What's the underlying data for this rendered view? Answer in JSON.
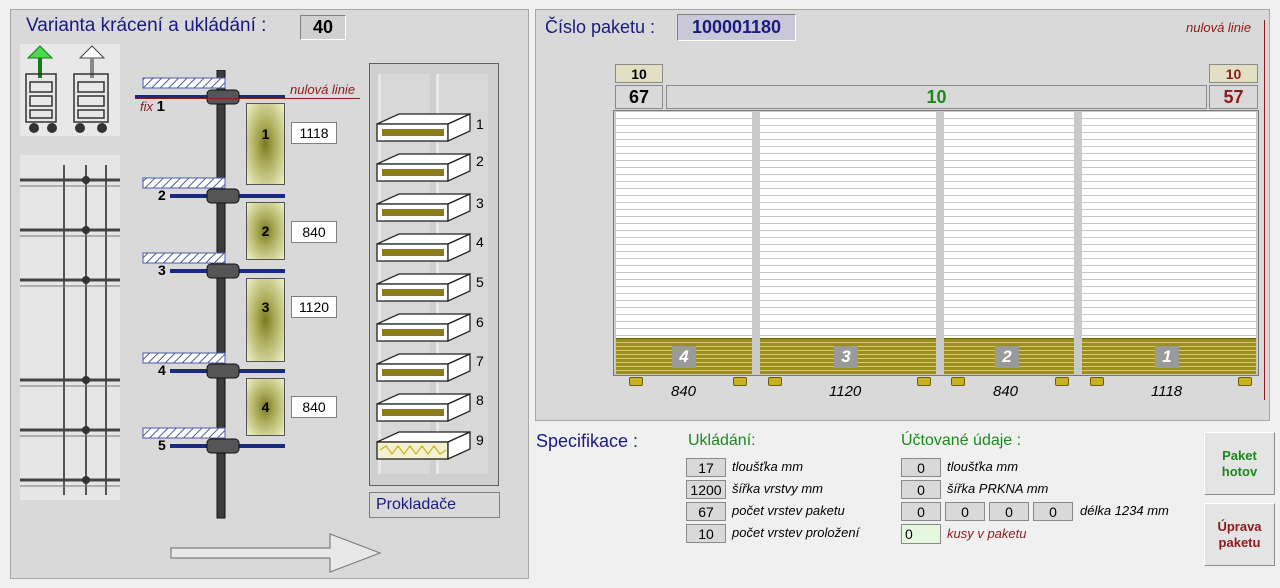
{
  "left_panel": {
    "title": "Varianta krácení a ukládání :",
    "variant_value": "40",
    "zero_line": "nulová linie",
    "fix_label": "fix",
    "fix_number": "1",
    "saw_numbers": [
      "2",
      "3",
      "4",
      "5"
    ],
    "segments": [
      {
        "index": "1",
        "length": "1118"
      },
      {
        "index": "2",
        "length": "840"
      },
      {
        "index": "3",
        "length": "1120"
      },
      {
        "index": "4",
        "length": "840"
      }
    ],
    "spacer_numbers": [
      "1",
      "2",
      "3",
      "4",
      "5",
      "6",
      "7",
      "8",
      "9"
    ],
    "spacer_button": "Prokladače"
  },
  "right_panel": {
    "packet_label": "Číslo paketu :",
    "packet_number": "100001180",
    "zero_line": "nulová linie",
    "left_small": "10",
    "left_big": "67",
    "center_value": "10",
    "right_small": "10",
    "right_big": "57",
    "stacks": [
      {
        "label": "4",
        "length": "840"
      },
      {
        "label": "3",
        "length": "1120"
      },
      {
        "label": "2",
        "length": "840"
      },
      {
        "label": "1",
        "length": "1118"
      }
    ]
  },
  "spec": {
    "title": "Specifikace :",
    "storing_title": "Ukládání:",
    "storing": [
      {
        "value": "17",
        "label": "tloušťka  mm"
      },
      {
        "value": "1200",
        "label": "šířka vrstvy  mm"
      },
      {
        "value": "67",
        "label": "počet vrstev paketu"
      },
      {
        "value": "10",
        "label": "počet vrstev proložení"
      }
    ],
    "billing_title": "Účtované údaje :",
    "billing_thickness": {
      "value": "0",
      "label": "tloušťka  mm"
    },
    "billing_width": {
      "value": "0",
      "label": "šířka PRKNA  mm"
    },
    "billing_lengths": [
      "0",
      "0",
      "0",
      "0"
    ],
    "billing_length_label": "délka 1234 mm",
    "billing_pieces": {
      "value": "0",
      "label": "kusy v paketu"
    }
  },
  "buttons": {
    "done": [
      "Paket",
      "hotov"
    ],
    "edit": [
      "Úprava",
      "paketu"
    ]
  },
  "colors": {
    "title_blue": "#1a1a80",
    "green": "#1a8a1a",
    "dark_red": "#8b1a1a",
    "olive": "#9b8d1f"
  }
}
